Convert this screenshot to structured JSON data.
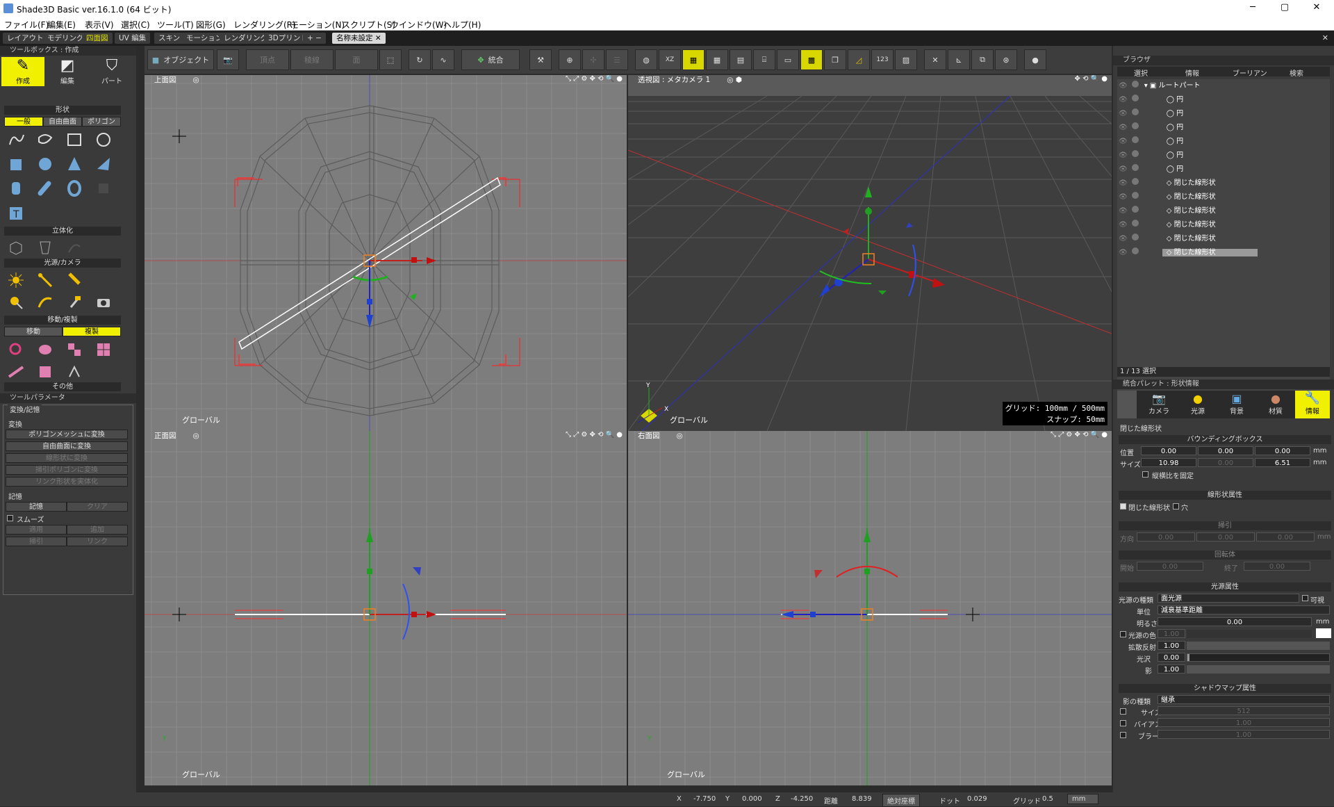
{
  "app": {
    "title": "Shade3D Basic ver.16.1.0 (64 ビット)"
  },
  "window_controls": {
    "min": "─",
    "max": "▢",
    "close": "✕"
  },
  "menu": [
    "ファイル(F)",
    "編集(E)",
    "表示(V)",
    "選択(C)",
    "ツール(T)",
    "図形(G)",
    "レンダリング(R)",
    "モーション(N)",
    "スクリプト(S)",
    "ウインドウ(W)",
    "ヘルプ(H)"
  ],
  "tabs": [
    "レイアウト",
    "モデリング",
    "四面図",
    "UV 編集",
    "スキン",
    "モーション",
    "レンダリング",
    "3Dプリント",
    "+ −"
  ],
  "doc_tab": "名称未設定",
  "toolbox": {
    "title": "ツールボックス : 作成",
    "modes": [
      "作成",
      "編集",
      "パート"
    ],
    "shape_header": "形状",
    "shape_tabs": [
      "一般",
      "自由曲面",
      "ポリゴン"
    ],
    "solid_header": "立体化",
    "light_header": "光源/カメラ",
    "move_header": "移動/複製",
    "move_tabs": [
      "移動",
      "複製"
    ],
    "other_header": "その他"
  },
  "tool_params": {
    "title": "ツールパラメータ",
    "group": "変換/記憶",
    "convert_header": "変換",
    "buttons": [
      "ポリゴンメッシュに変換",
      "自由曲面に変換",
      "線形状に変換",
      "掃引ポリゴンに変換",
      "リンク形状を実体化"
    ],
    "memory_header": "記憶",
    "memory_buttons": [
      "記憶",
      "クリア"
    ],
    "smooth": "スムーズ",
    "apply_buttons": [
      "適用",
      "追加"
    ],
    "sweep_buttons": [
      "掃引",
      "リンク"
    ]
  },
  "main_toolbar": {
    "object": "オブジェクト",
    "vertex": "頂点",
    "edge": "稜線",
    "face": "面",
    "merge": "統合",
    "xz": "XZ",
    "num": "123"
  },
  "viewports": {
    "top": {
      "name": "上面図",
      "footer": "グローバル"
    },
    "perspective": {
      "name": "透視図 : メタカメラ 1",
      "footer": "グローバル",
      "grid": "グリッド: 100mm / 500mm",
      "snap": "スナップ: 50mm",
      "axis_y": "Y",
      "axis_x": "X"
    },
    "front": {
      "name": "正面図",
      "footer": "グローバル",
      "axis_y": "Y"
    },
    "right": {
      "name": "右面図",
      "footer": "グローバル",
      "axis_y": "Y"
    }
  },
  "browser": {
    "title": "ブラウザ",
    "tabs": [
      "選択",
      "情報",
      "ブーリアン",
      "検索"
    ],
    "root": "ルートパート",
    "items": [
      "円",
      "円",
      "円",
      "円",
      "円",
      "円",
      "閉じた線形状",
      "閉じた線形状",
      "閉じた線形状",
      "閉じた線形状",
      "閉じた線形状",
      "閉じた線形状"
    ],
    "selection_status": "1 / 13 選択"
  },
  "integrated": {
    "title": "統合パレット : 形状情報",
    "tabs": [
      "カメラ",
      "光源",
      "背景",
      "材質",
      "情報"
    ],
    "shape_name": "閉じた線形状",
    "bbox_header": "バウンディングボックス",
    "position_label": "位置",
    "position": [
      "0.00",
      "0.00",
      "0.00"
    ],
    "size_label": "サイズ",
    "size": [
      "10.98",
      "0.00",
      "6.51"
    ],
    "unit": "mm",
    "aspect_lock": "縦横比を固定",
    "line_attr_header": "線形状属性",
    "closed_line": "閉じた線形状",
    "hole": "穴",
    "sweep_header": "掃引",
    "direction_label": "方向",
    "sweep_vals": [
      "0.00",
      "0.00",
      "0.00"
    ],
    "revolve_header": "回転体",
    "start_label": "開始",
    "start_val": "0.00",
    "end_label": "終了",
    "end_val": "0.00",
    "light_header": "光源属性",
    "light_type_label": "光源の種類",
    "light_type": "面光源",
    "visible": "可視",
    "unit_label": "単位",
    "unit_val": "減衰基準距離",
    "brightness_label": "明るさ",
    "brightness": "0.00",
    "light_color_label": "光源の色",
    "light_color_val": "1.00",
    "diffuse_label": "拡散反射",
    "diffuse": "1.00",
    "gloss_label": "光沢",
    "gloss": "0.00",
    "shadow_label": "影",
    "shadow": "1.00",
    "shadowmap_header": "シャドウマップ属性",
    "shadow_type_label": "影の種類",
    "shadow_type": "継承",
    "sm_size_label": "サイズ",
    "sm_size": "512",
    "bias_label": "バイアス",
    "bias": "1.00",
    "blur_label": "ブラー",
    "blur": "1.00"
  },
  "status": {
    "x_label": "X",
    "x": "-7.750",
    "y_label": "Y",
    "y": "0.000",
    "z_label": "Z",
    "z": "-4.250",
    "dist_label": "距離",
    "dist": "8.839",
    "mode": "絶対座標",
    "dot_label": "ドット",
    "dot": "0.029",
    "grid_label": "グリッド",
    "grid": "0.5",
    "unit": "mm"
  },
  "colors": {
    "accent_yellow": "#f0f000",
    "viewport_bg": "#7d7d7d",
    "persp_bg": "#3e3e3e",
    "x_axis": "#d02020",
    "y_axis": "#20b020",
    "z_axis": "#2040d0",
    "select_orange": "#f08020"
  }
}
